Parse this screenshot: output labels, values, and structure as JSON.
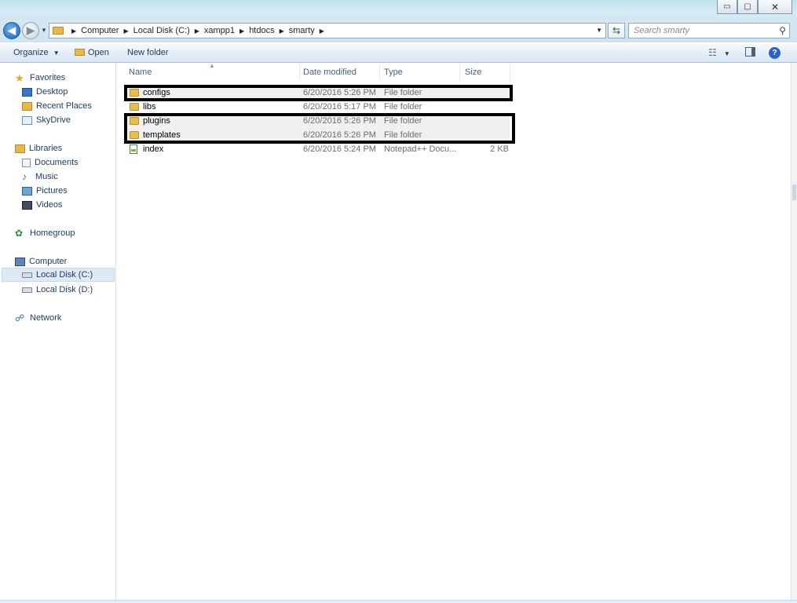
{
  "window": {
    "controls": {
      "minimize": "▭",
      "maximize": "▢",
      "close": "✕"
    }
  },
  "address": {
    "crumbs": [
      "Computer",
      "Local Disk (C:)",
      "xampp1",
      "htdocs",
      "smarty"
    ],
    "search_placeholder": "Search smarty"
  },
  "toolbar": {
    "organize": "Organize",
    "open": "Open",
    "new_folder": "New folder"
  },
  "sidebar": {
    "favorites": {
      "label": "Favorites",
      "items": [
        "Desktop",
        "Recent Places",
        "SkyDrive"
      ]
    },
    "libraries": {
      "label": "Libraries",
      "items": [
        "Documents",
        "Music",
        "Pictures",
        "Videos"
      ]
    },
    "homegroup": "Homegroup",
    "computer": {
      "label": "Computer",
      "items": [
        "Local Disk (C:)",
        "Local Disk (D:)"
      ],
      "selected": "Local Disk (C:)"
    },
    "network": "Network"
  },
  "columns": {
    "name": "Name",
    "date": "Date modified",
    "type": "Type",
    "size": "Size"
  },
  "files": [
    {
      "name": "configs",
      "date": "6/20/2016 5:26 PM",
      "type": "File folder",
      "size": "",
      "icon": "folder-icon",
      "boxed": true
    },
    {
      "name": "libs",
      "date": "6/20/2016 5:17 PM",
      "type": "File folder",
      "size": "",
      "icon": "folder-icon",
      "boxed": false
    },
    {
      "name": "plugins",
      "date": "6/20/2016 5:26 PM",
      "type": "File folder",
      "size": "",
      "icon": "folder-icon",
      "boxed": true
    },
    {
      "name": "templates",
      "date": "6/20/2016 5:26 PM",
      "type": "File folder",
      "size": "",
      "icon": "folder-icon",
      "boxed": true
    },
    {
      "name": "index",
      "date": "6/20/2016 5:24 PM",
      "type": "Notepad++ Docu...",
      "size": "2 KB",
      "icon": "notepad-file-icon",
      "boxed": false
    }
  ],
  "colors": {
    "accent": "#1e395b",
    "highlight_box": "#000000",
    "folder": "#e8bf4f"
  }
}
